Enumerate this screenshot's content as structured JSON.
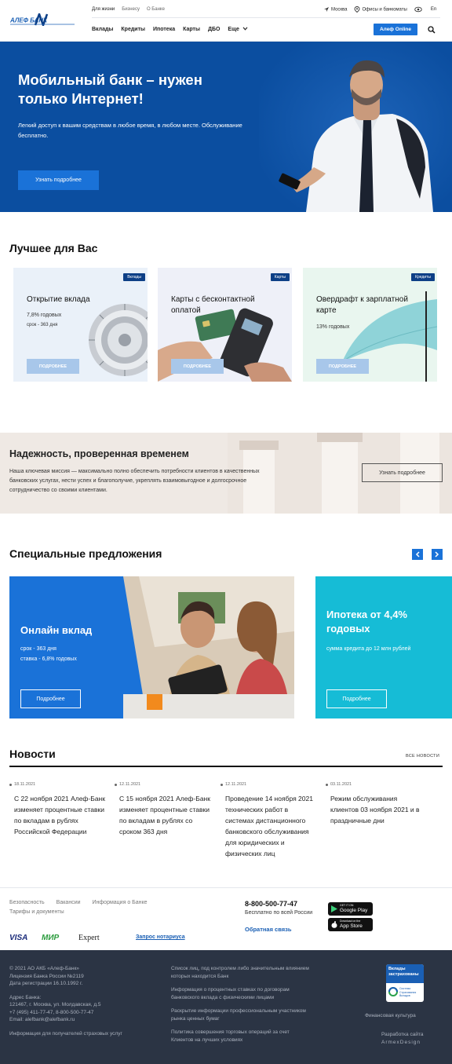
{
  "header": {
    "logo_text": "АЛЕФ БАНК",
    "top_links": [
      "Для жизни",
      "Бизнесу",
      "О Банке"
    ],
    "city": "Москва",
    "offices": "Офисы и банкоматы",
    "lang": "En",
    "nav": [
      "Вклады",
      "Кредиты",
      "Ипотека",
      "Карты",
      "ДБО",
      "Еще"
    ],
    "online_button": "Алеф Online"
  },
  "hero": {
    "title": "Мобильный банк – нужен только Интернет!",
    "text": "Легкий доступ к вашим средствам в любое время, в любом месте. Обслуживание бесплатно.",
    "button": "Узнать подробнее"
  },
  "best": {
    "title": "Лучшее для Вас",
    "cards": [
      {
        "badge": "Вклады",
        "title": "Открытие вклада",
        "sub1": "7,8% годовых",
        "sub2": "срок - 363 дня",
        "button": "ПОДРОБНЕЕ"
      },
      {
        "badge": "Карты",
        "title": "Карты с бесконтактной оплатой",
        "sub1": "",
        "sub2": "",
        "button": "ПОДРОБНЕЕ"
      },
      {
        "badge": "Кредиты",
        "title": "Овердрафт к зарплатной карте",
        "sub1": "13% годовых",
        "sub2": "",
        "button": "ПОДРОБНЕЕ"
      }
    ]
  },
  "reliability": {
    "title": "Надежность, проверенная временем",
    "text": "Наша ключевая миссия — максимально полно обеспечить потребности клиентов в качественных банковских услугах, нести успех и благополучие, укреплять взаимовыгодное и долгосрочное сотрудничество со своими клиентами.",
    "button": "Узнать подробнее"
  },
  "special": {
    "title": "Специальные предложения",
    "offers": [
      {
        "title": "Онлайн вклад",
        "line1": "срок - 363 дня",
        "line2": "ставка - 6,8% годовых",
        "button": "Подробнее"
      },
      {
        "title": "Ипотека от 4,4% годовых",
        "line1": "сумма кредита до 12 млн рублей",
        "line2": "",
        "button": "Подробнее"
      }
    ]
  },
  "news": {
    "title": "Новости",
    "all_link": "ВСЕ НОВОСТИ",
    "items": [
      {
        "date": "18.11.2021",
        "text": "С 22 ноября 2021 Алеф-Банк изменяет процентные ставки по вкладам в рублях Российской Федерации"
      },
      {
        "date": "12.11.2021",
        "text": "С 15 ноября 2021 Алеф-Банк изменяет процентные ставки по вкладам в рублях со сроком 363 дня"
      },
      {
        "date": "12.11.2021",
        "text": "Проведение 14 ноября 2021 технических работ в системах дистанционного банковского обслуживания для юридических и физических лиц"
      },
      {
        "date": "03.11.2021",
        "text": "Режим обслуживания клиентов 03 ноября 2021 и в праздничные дни"
      }
    ]
  },
  "footer_top": {
    "links": [
      "Безопасность",
      "Вакансии",
      "Информация о Банке",
      "Тарифы и документы"
    ],
    "payments": [
      "VISA",
      "МИР",
      "Expert"
    ],
    "notary": "Запрос нотариуса",
    "phone": "8-800-500-77-47",
    "phone_note": "Бесплатно по всей России",
    "feedback": "Обратная связь",
    "google_small": "GET IT ON",
    "google": "Google Play",
    "apple_small": "Download on the",
    "apple": "App Store"
  },
  "footer_bottom": {
    "copyright": "© 2021 АО АКБ «Алеф-Банк»",
    "license": "Лицензия Банка России №2119",
    "regdate": "Дата регистрации 16.10.1992 г.",
    "address_label": "Адрес Банка:",
    "address": "121467, г. Москва, ул. Молдавская, д.5",
    "phones": "+7 (495) 411-77-47, 8-800-500-77-47",
    "email": "Email: alefbank@alefbank.ru",
    "securities": "Информация для получателей страховых услуг",
    "mid": [
      "Список лиц, под контролем либо значительным влиянием которых находится Банк",
      "Информация о процентных ставках по договорам банковского вклада с физическими лицами",
      "Раскрытие информации профессиональным участником рынка ценных бумаг",
      "Политика совершения торговых операций за счет Клиентов на лучших условиях"
    ],
    "insured_title": "Вклады застрахованы",
    "insured_sub": "Система Страхования Вкладов",
    "fin_culture": "Финансовая культура",
    "dev_label": "Разработка сайта",
    "dev": "ArmexDesign"
  },
  "colors": {
    "primary": "#1a72d8",
    "dark_blue": "#0b4ea0",
    "teal": "#16bcd6",
    "footer": "#2b3444"
  }
}
